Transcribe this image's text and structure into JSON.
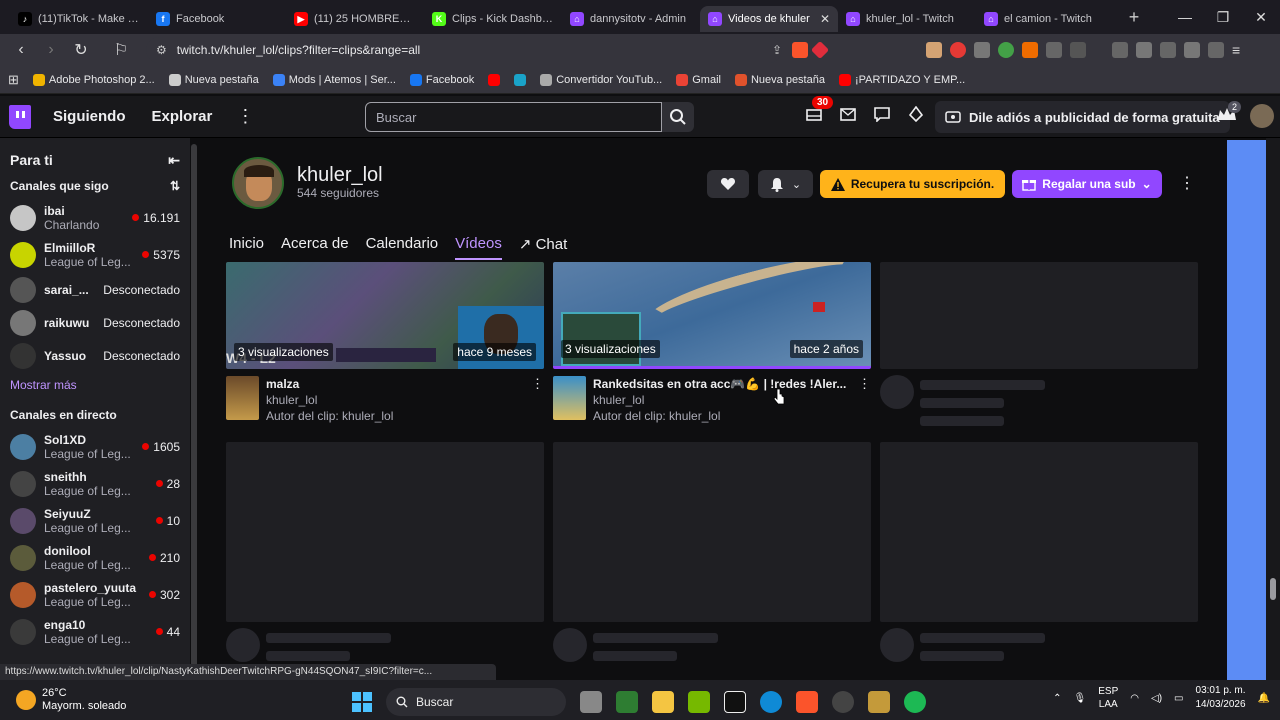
{
  "browser": {
    "tabs": [
      {
        "label": "(11)TikTok - Make You",
        "color": "#000000",
        "glyph": "♪"
      },
      {
        "label": "Facebook",
        "color": "#1877f2",
        "glyph": "f"
      },
      {
        "label": "(11) 25 HOMBRES EL",
        "color": "#ff0000",
        "glyph": "▶"
      },
      {
        "label": "Clips - Kick Dashboar",
        "color": "#53fc18",
        "glyph": "K"
      },
      {
        "label": "dannysitotv - Admin",
        "color": "#9147ff",
        "glyph": "⌂"
      },
      {
        "label": "Videos de khuler",
        "color": "#9147ff",
        "glyph": "⌂",
        "active": true
      },
      {
        "label": "khuler_lol - Twitch",
        "color": "#9147ff",
        "glyph": "⌂"
      },
      {
        "label": "el camion - Twitch",
        "color": "#9147ff",
        "glyph": "⌂"
      }
    ],
    "url": "twitch.tv/khuler_lol/clips?filter=clips&range=all",
    "bookmarks": [
      {
        "label": "Adobe Photoshop 2...",
        "color": "#f0b400"
      },
      {
        "label": "Nueva pestaña",
        "color": "#cccccc"
      },
      {
        "label": "Mods | Atemos | Ser...",
        "color": "#3b82f6"
      },
      {
        "label": "Facebook",
        "color": "#1877f2"
      },
      {
        "label": "",
        "color": "#ff0000"
      },
      {
        "label": "",
        "color": "#1aa3c9"
      },
      {
        "label": "Convertidor YouTub...",
        "color": "#aaaaaa"
      },
      {
        "label": "Gmail",
        "color": "#ea4335"
      },
      {
        "label": "Nueva pestaña",
        "color": "#e0522c"
      },
      {
        "label": "¡PARTIDAZO Y EMP...",
        "color": "#ff0000"
      }
    ]
  },
  "twitch": {
    "nav": {
      "following": "Siguiendo",
      "explore": "Explorar",
      "search_placeholder": "Buscar",
      "notifications_count": "30",
      "adfree": "Dile adiós a publicidad de forma gratuita",
      "crown_count": "2"
    },
    "sidebar": {
      "title": "Para ti",
      "followed_title": "Canales que sigo",
      "followed": [
        {
          "name": "ibai",
          "game": "Charlando",
          "viewers": "16.191",
          "live": true,
          "color": "#c6c6c6"
        },
        {
          "name": "ElmiilloR",
          "game": "League of Leg...",
          "viewers": "5375",
          "live": true,
          "color": "#c8d400"
        },
        {
          "name": "sarai_...",
          "status": "Desconectado",
          "live": false,
          "color": "#555555"
        },
        {
          "name": "raikuwu",
          "status": "Desconectado",
          "live": false,
          "color": "#777777"
        },
        {
          "name": "Yassuo",
          "status": "Desconectado",
          "live": false,
          "color": "#333333"
        }
      ],
      "show_more": "Mostrar más",
      "live_title": "Canales en directo",
      "live": [
        {
          "name": "Sol1XD",
          "game": "League of Leg...",
          "viewers": "1605",
          "color": "#4c7fa3"
        },
        {
          "name": "sneithh",
          "game": "League of Leg...",
          "viewers": "28",
          "color": "#444444"
        },
        {
          "name": "SeiyuuZ",
          "game": "League of Leg...",
          "viewers": "10",
          "color": "#5a4a6a"
        },
        {
          "name": "donilool",
          "game": "League of Leg...",
          "viewers": "210",
          "color": "#5b5b3b"
        },
        {
          "name": "pastelero_yuuta",
          "game": "League of Leg...",
          "viewers": "302",
          "color": "#b55a2a"
        },
        {
          "name": "enga10",
          "game": "League of Leg...",
          "viewers": "44",
          "color": "#3a3a3a"
        }
      ]
    },
    "channel": {
      "name": "khuler_lol",
      "followers": "544 seguidores",
      "resub": "Recupera tu suscripción.",
      "gift": "Regalar una sub",
      "tabs": [
        "Inicio",
        "Acerca de",
        "Calendario",
        "Vídeos",
        "Chat"
      ],
      "selected_tab": "Vídeos"
    },
    "clips": [
      {
        "title": "malza",
        "channel": "khuler_lol",
        "author": "Autor del clip: khuler_lol",
        "views": "3 visualizaciones",
        "age": "hace 9 meses",
        "thumb_text": "W4 - L2"
      },
      {
        "title": "Rankedsitas en otra acc🎮💪 | !redes !Aler...",
        "channel": "khuler_lol",
        "author": "Autor del clip: khuler_lol",
        "views": "3 visualizaciones",
        "age": "hace 2 años"
      }
    ],
    "status_url": "https://www.twitch.tv/khuler_lol/clip/NastyKathishDeerTwitchRPG-gN44SQON47_sI9IC?filter=c..."
  },
  "taskbar": {
    "temp": "26°C",
    "weather": "Mayorm. soleado",
    "search": "Buscar",
    "lang1": "ESP",
    "lang2": "LAA",
    "time": "03:01 p. m.",
    "date": "14/03/2026"
  },
  "colors": {
    "twitch_purple": "#9147ff",
    "accent_light": "#bf94ff",
    "resub_yellow": "#ffb31a",
    "live_red": "#eb0400"
  }
}
